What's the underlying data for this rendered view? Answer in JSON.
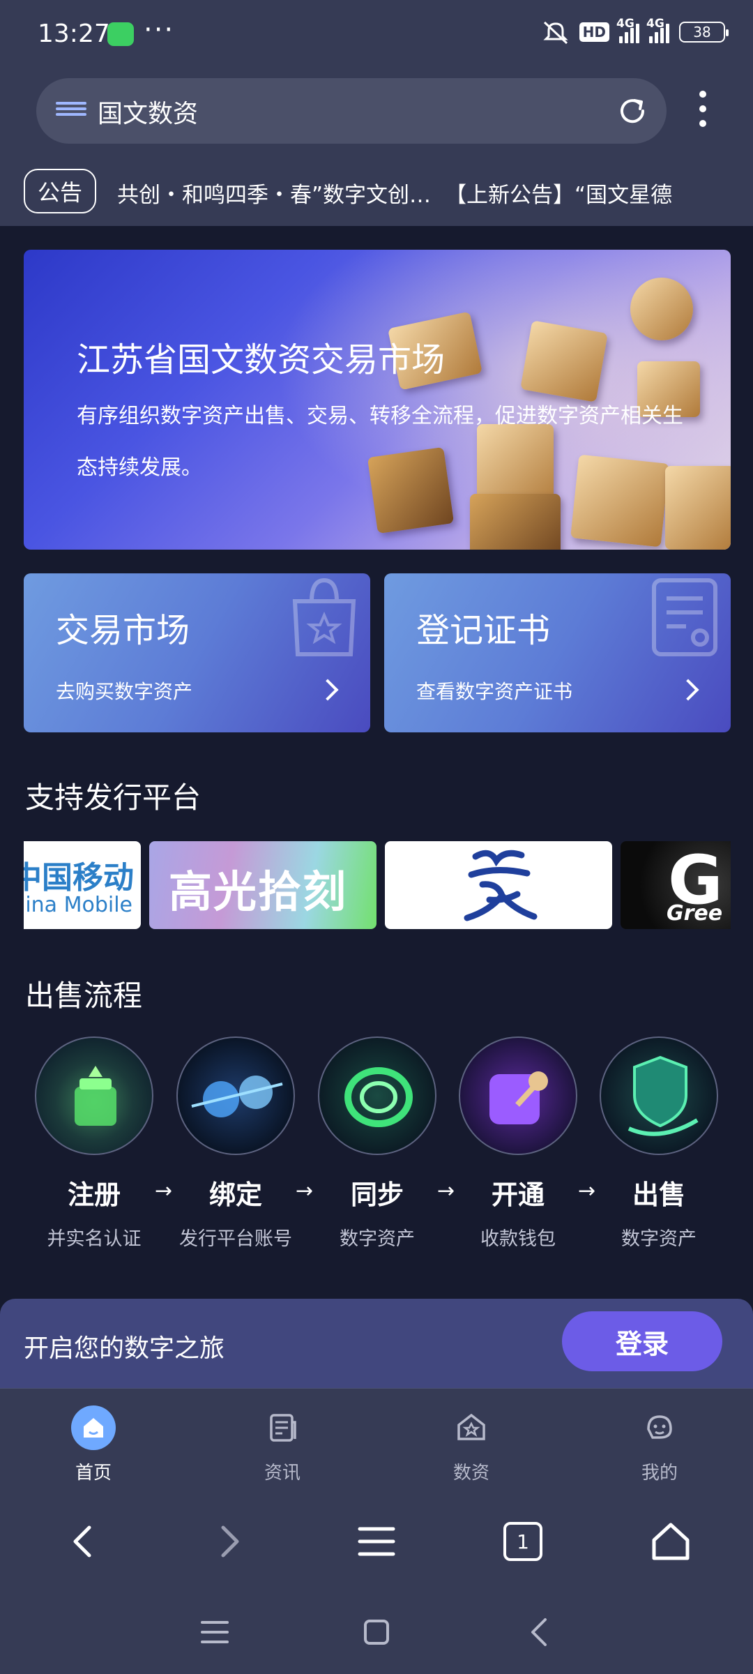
{
  "status_bar": {
    "time": "13:27",
    "dots": "···",
    "hd": "HD",
    "network1": "4G",
    "network2": "4G",
    "battery": "38"
  },
  "browser": {
    "url_text": "国文数资",
    "notice_badge": "公告",
    "notices": [
      "共创・和鸣四季・春”数字文创…",
      "【上新公告】“国文星德"
    ]
  },
  "banner": {
    "title": "江苏省国文数资交易市场",
    "description": "有序组织数字资产出售、交易、转移全流程，促进数字资产相关生态持续发展。"
  },
  "cards": [
    {
      "title": "交易市场",
      "subtitle": "去购买数字资产"
    },
    {
      "title": "登记证书",
      "subtitle": "查看数字资产证书"
    }
  ],
  "platforms": {
    "section_title": "支持发行平台",
    "items": [
      {
        "name": "中国移动",
        "subtitle": "China Mobile"
      },
      {
        "name": "高光拾刻"
      },
      {
        "name": "jiangsu-logo"
      },
      {
        "name": "G",
        "subtitle": "Gree"
      }
    ]
  },
  "process": {
    "section_title": "出售流程",
    "arrow": "→",
    "steps": [
      {
        "name": "注册",
        "sub": "并实名认证"
      },
      {
        "name": "绑定",
        "sub": "发行平台账号"
      },
      {
        "name": "同步",
        "sub": "数字资产"
      },
      {
        "name": "开通",
        "sub": "收款钱包"
      },
      {
        "name": "出售",
        "sub": "数字资产"
      }
    ]
  },
  "login_bar": {
    "text": "开启您的数字之旅",
    "button": "登录"
  },
  "tabbar": {
    "items": [
      {
        "label": "首页",
        "icon": "home-icon"
      },
      {
        "label": "资讯",
        "icon": "news-icon"
      },
      {
        "label": "数资",
        "icon": "asset-icon"
      },
      {
        "label": "我的",
        "icon": "profile-icon"
      }
    ]
  },
  "browser_nav": {
    "tab_count": "1"
  },
  "colors": {
    "background": "#161a2e",
    "bars": "#363b55",
    "login_bar": "#41477e",
    "accent": "#6c5ce7",
    "active_tab": "#6fa9ff"
  }
}
